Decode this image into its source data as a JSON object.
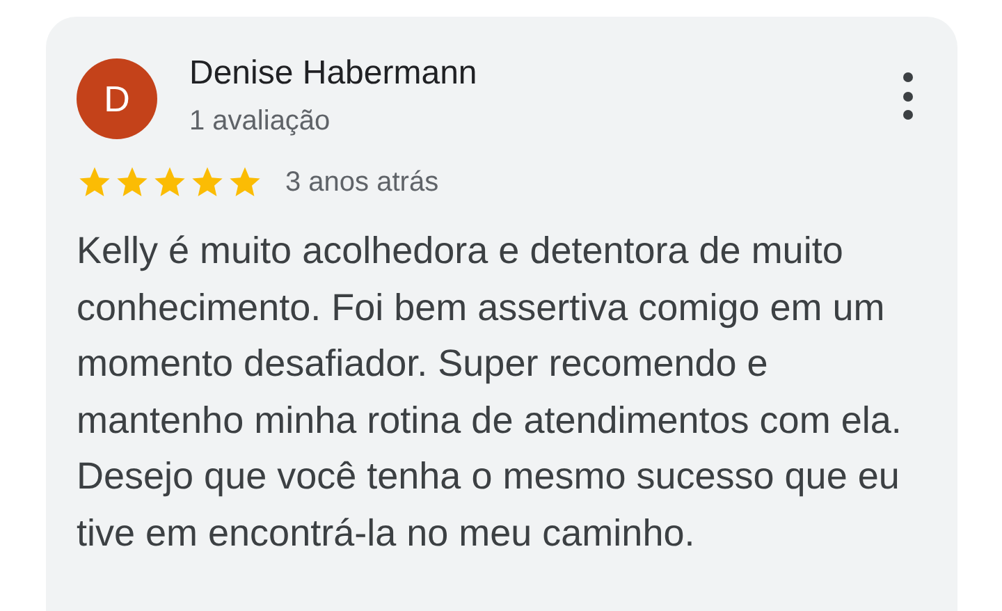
{
  "review": {
    "avatar_letter": "D",
    "author": "Denise Habermann",
    "meta": "1 avaliação",
    "stars": 5,
    "time": "3 anos atrás",
    "text": "Kelly é muito acolhedora e detentora de muito conhecimento. Foi bem assertiva comigo em um momento desafiador. Super recomendo e mantenho minha rotina de atendimentos com ela. Desejo que você tenha o mesmo sucesso que eu tive em encontrá-la no meu caminho."
  }
}
